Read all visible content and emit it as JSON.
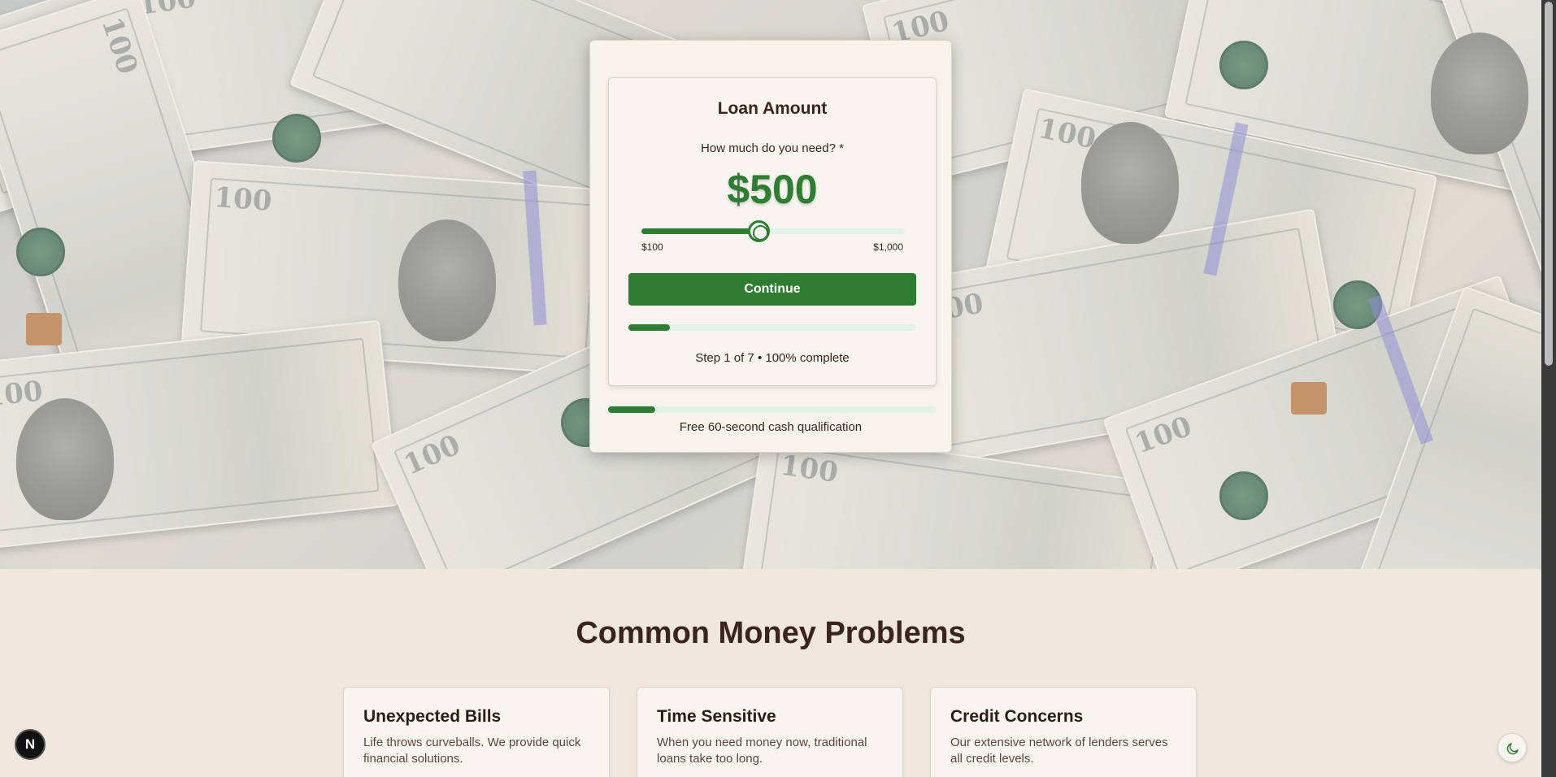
{
  "form": {
    "step_title": "Loan Amount",
    "question": "How much do you need? *",
    "amount_display": "$500",
    "slider": {
      "min_label": "$100",
      "max_label": "$1,000",
      "value": 500,
      "min": 100,
      "max": 1000,
      "fill_fraction": 0.444
    },
    "continue_label": "Continue",
    "step_progress_fraction": 0.143,
    "step_status": "Step 1 of 7 • 100% complete",
    "outer_progress_fraction": 0.143,
    "tagline": "Free 60-second cash qualification"
  },
  "section": {
    "title": "Common Money Problems",
    "cards": [
      {
        "title": "Unexpected Bills",
        "desc": "Life throws curveballs. We provide quick financial solutions."
      },
      {
        "title": "Time Sensitive",
        "desc": "When you need money now, traditional loans take too long."
      },
      {
        "title": "Credit Concerns",
        "desc": "Our extensive network of lenders serves all credit levels."
      }
    ]
  },
  "dev_badge": {
    "label": "N"
  },
  "theme_toggle": {
    "icon": "moon-icon"
  },
  "colors": {
    "accent": "#2e7d32",
    "track": "#e3f2e7",
    "text": "#3a2420",
    "page_bg": "#f0e8df"
  }
}
